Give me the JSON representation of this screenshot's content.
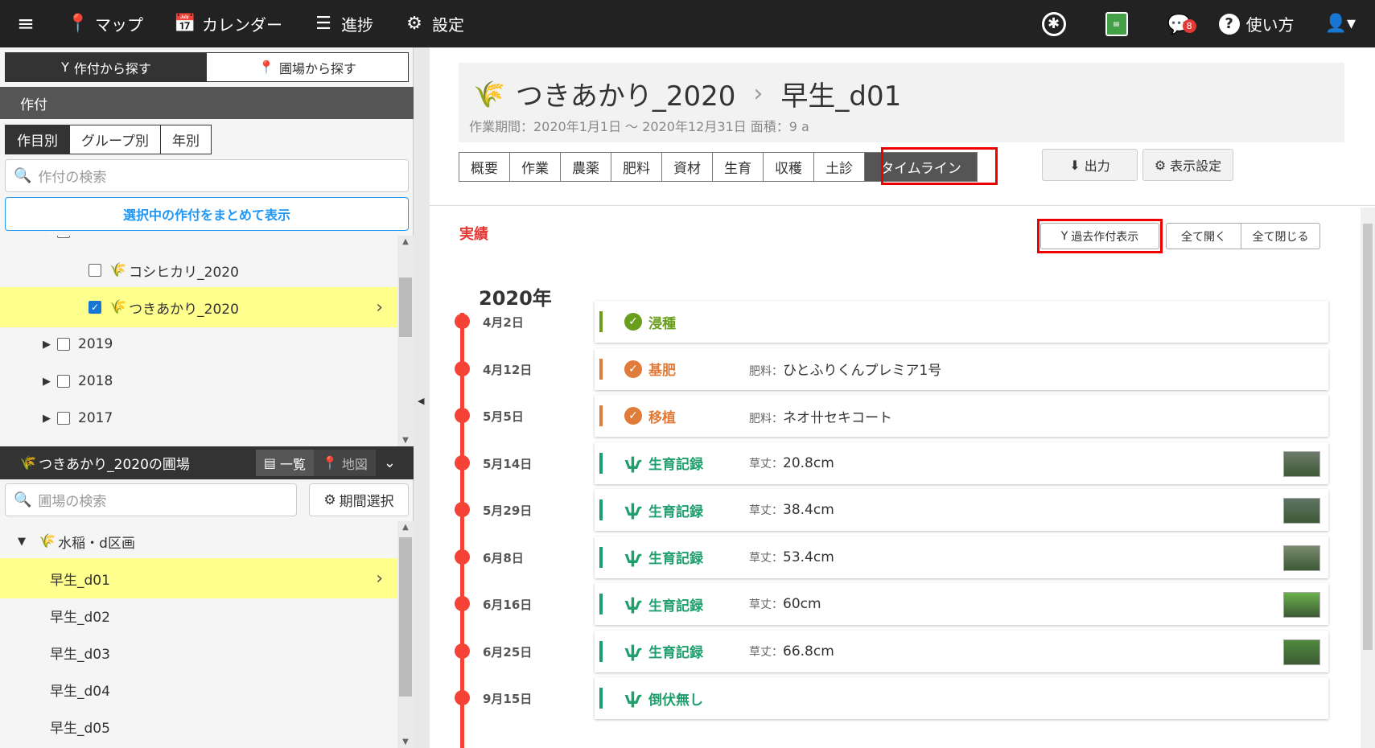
{
  "nav": {
    "items": [
      {
        "icon": "map-pin-icon",
        "glyph": "📍",
        "label": "マップ"
      },
      {
        "icon": "calendar-icon",
        "glyph": "📅",
        "label": "カレンダー"
      },
      {
        "icon": "progress-list-icon",
        "glyph": "☰",
        "label": "進捗"
      },
      {
        "icon": "gear-icon",
        "glyph": "⚙",
        "label": "設定"
      }
    ],
    "notification_count": "8",
    "help_label": "使い方"
  },
  "sidebar": {
    "mode_tabs": [
      "作付から探す",
      "圃場から探す"
    ],
    "section_title": "作付",
    "group_tabs": [
      "作目別",
      "グループ別",
      "年別"
    ],
    "search_placeholder": "作付の検索",
    "bulk_button": "選択中の作付をまとめて表示",
    "tree": {
      "partial_year": "2020",
      "crops": [
        {
          "label": "コシヒカリ_2020",
          "checked": false
        },
        {
          "label": "つきあかり_2020",
          "checked": true
        }
      ],
      "years": [
        "2019",
        "2018",
        "2017"
      ]
    },
    "field_section_title": "つきあかり_2020の圃場",
    "field_view_list": "一覧",
    "field_view_map": "地図",
    "field_search_placeholder": "圃場の検索",
    "period_button": "期間選択",
    "field_group": "水稲・d区画",
    "fields": [
      "早生_d01",
      "早生_d02",
      "早生_d03",
      "早生_d04",
      "早生_d05"
    ]
  },
  "main": {
    "crop_title": "つきあかり_2020",
    "field_title": "早生_d01",
    "subtitle": "作業期間：2020年1月1日 〜 2020年12月31日 面積：9 a",
    "tabs": [
      "概要",
      "作業",
      "農薬",
      "肥料",
      "資材",
      "生育",
      "収穫",
      "土診",
      "タイムライン"
    ],
    "output_button": "出力",
    "display_settings_button": "表示設定",
    "section_title": "実績",
    "past_crop_button": "過去作付表示",
    "expand_all": "全て開く",
    "collapse_all": "全て閉じる",
    "year_heading": "2020年",
    "timeline": [
      {
        "date": "4月2日",
        "label": "浸種",
        "detail_key": "",
        "detail_value": "",
        "color": "#6a9f1e",
        "icon": "check-circle-icon",
        "photo": false
      },
      {
        "date": "4月12日",
        "label": "基肥",
        "detail_key": "肥料：",
        "detail_value": "ひとふりくんプレミア1号",
        "color": "#e07b39",
        "icon": "check-circle-icon",
        "photo": false
      },
      {
        "date": "5月5日",
        "label": "移植",
        "detail_key": "肥料：",
        "detail_value": "ネオ卄セキコート",
        "color": "#e07b39",
        "icon": "check-circle-icon",
        "photo": false
      },
      {
        "date": "5月14日",
        "label": "生育記録",
        "detail_key": "草丈：",
        "detail_value": "20.8cm",
        "color": "#1f9e6e",
        "icon": "growth-icon",
        "photo": true
      },
      {
        "date": "5月29日",
        "label": "生育記録",
        "detail_key": "草丈：",
        "detail_value": "38.4cm",
        "color": "#1f9e6e",
        "icon": "growth-icon",
        "photo": true
      },
      {
        "date": "6月8日",
        "label": "生育記録",
        "detail_key": "草丈：",
        "detail_value": "53.4cm",
        "color": "#1f9e6e",
        "icon": "growth-icon",
        "photo": true
      },
      {
        "date": "6月16日",
        "label": "生育記録",
        "detail_key": "草丈：",
        "detail_value": "60cm",
        "color": "#1f9e6e",
        "icon": "growth-icon",
        "photo": true
      },
      {
        "date": "6月25日",
        "label": "生育記録",
        "detail_key": "草丈：",
        "detail_value": "66.8cm",
        "color": "#1f9e6e",
        "icon": "growth-icon",
        "photo": true
      },
      {
        "date": "9月15日",
        "label": "倒伏無し",
        "detail_key": "",
        "detail_value": "",
        "color": "#1f9e6e",
        "icon": "growth-icon",
        "photo": false
      }
    ]
  }
}
